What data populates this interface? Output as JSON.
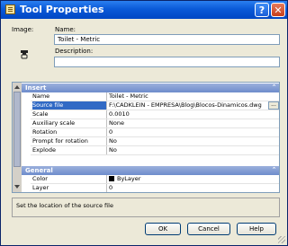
{
  "window": {
    "title": "Tool Properties",
    "help_label": "?",
    "close_label": "✕"
  },
  "image_label": "Image:",
  "name_label": "Name:",
  "name_value": "Toilet - Metric",
  "description_label": "Description:",
  "description_value": "",
  "sections": {
    "insert": {
      "title": "Insert",
      "collapse_glyph": "⌃"
    },
    "general": {
      "title": "General",
      "collapse_glyph": "⌃"
    }
  },
  "insert_rows": [
    {
      "name": "Name",
      "value": "Toilet - Metric"
    },
    {
      "name": "Source file",
      "value": "F:\\CADKLEIN - EMPRESA\\Blog\\Blocos-Dinamicos.dwg"
    },
    {
      "name": "Scale",
      "value": "0.0010"
    },
    {
      "name": "Auxiliary scale",
      "value": "None"
    },
    {
      "name": "Rotation",
      "value": "0"
    },
    {
      "name": "Prompt for rotation",
      "value": "No"
    },
    {
      "name": "Explode",
      "value": "No"
    }
  ],
  "general_rows": [
    {
      "name": "Color",
      "value": "ByLayer"
    },
    {
      "name": "Layer",
      "value": "0"
    }
  ],
  "browse_label": "...",
  "description_text": "Set the location of the source file",
  "buttons": {
    "ok": "OK",
    "cancel": "Cancel",
    "help": "Help"
  }
}
